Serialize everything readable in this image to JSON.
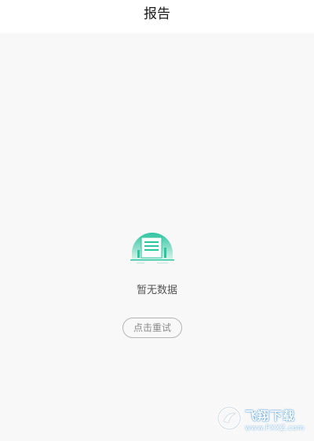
{
  "header": {
    "title": "报告"
  },
  "empty_state": {
    "icon": "empty-report-illustration",
    "message": "暂无数据",
    "retry_label": "点击重试"
  },
  "watermark": {
    "title": "飞翔下载",
    "url": "www.FXXZ.com"
  },
  "colors": {
    "accent_green": "#2ec4a0",
    "background": "#f8f8f8",
    "header_bg": "#ffffff"
  }
}
